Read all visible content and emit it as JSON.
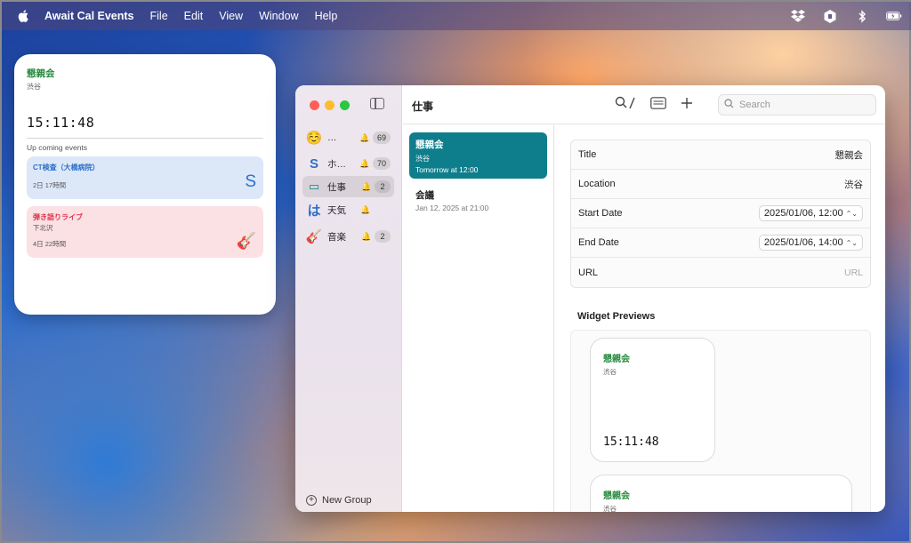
{
  "menubar": {
    "app_name": "Await Cal Events",
    "menus": [
      "File",
      "Edit",
      "View",
      "Window",
      "Help"
    ],
    "status_icons": [
      "dropbox-icon",
      "app-status-icon",
      "bluetooth-icon",
      "battery-icon"
    ]
  },
  "widget": {
    "title": "懇親会",
    "location": "渋谷",
    "clock": "15:11:48",
    "upcoming_label": "Up coming events",
    "events": [
      {
        "title": "CT検査（大橋病院）",
        "subtitle": "",
        "remaining": "2日 17時間",
        "badge": "S"
      },
      {
        "title": "弾き語りライブ",
        "subtitle": "下北沢",
        "remaining": "4日 22時間",
        "badge": "🎸"
      }
    ]
  },
  "sidebar": {
    "groups": [
      {
        "icon": "☺️",
        "label": "…",
        "count": "69"
      },
      {
        "icon": "S",
        "label": "ホ…",
        "count": "70"
      },
      {
        "icon": "▭",
        "label": "仕事",
        "count": "2"
      },
      {
        "icon": "は",
        "label": "天気",
        "count": ""
      },
      {
        "icon": "🎸",
        "label": "音楽",
        "count": "2"
      }
    ],
    "new_group_label": "New Group"
  },
  "toolbar": {
    "title": "仕事",
    "search_placeholder": "Search"
  },
  "events_list": [
    {
      "title": "懇親会",
      "location": "渋谷",
      "date": "Tomorrow at 12:00"
    },
    {
      "title": "会議",
      "location": "",
      "date": "Jan 12, 2025 at 21:00"
    }
  ],
  "detail": {
    "title_label": "Title",
    "title_value": "懇親会",
    "location_label": "Location",
    "location_value": "渋谷",
    "start_label": "Start Date",
    "start_value": "2025/01/06, 12:00",
    "end_label": "End Date",
    "end_value": "2025/01/06, 14:00",
    "url_label": "URL",
    "url_placeholder": "URL",
    "widget_previews_label": "Widget Previews",
    "preview_small": {
      "title": "懇親会",
      "location": "渋谷",
      "clock": "15:11:48"
    },
    "preview_medium": {
      "title": "懇親会",
      "location": "渋谷"
    }
  },
  "colors": {
    "accent_teal": "#0f7e8c",
    "event_green": "#248a3d",
    "blue_card": "#dce8f8",
    "pink_card": "#fbe0e4"
  }
}
